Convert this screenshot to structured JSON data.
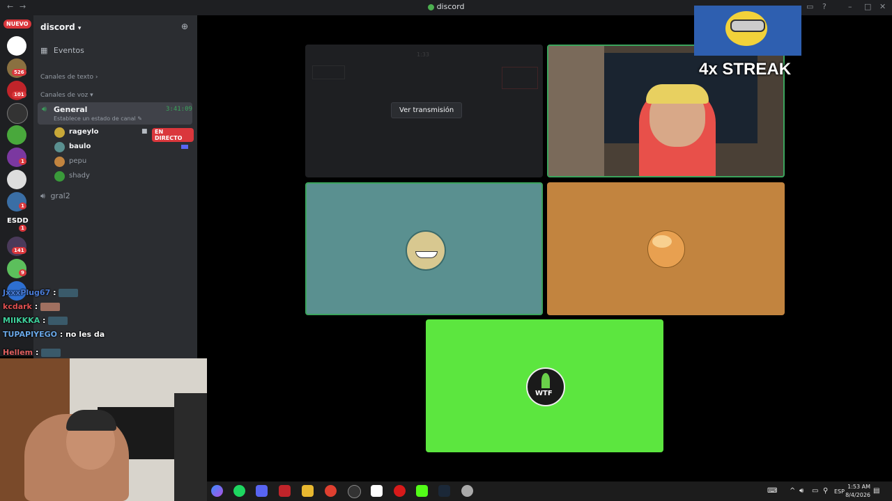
{
  "window": {
    "title": "discord"
  },
  "rail": {
    "nuevo_label": "NUEVO",
    "server_badges": [
      "526",
      "101",
      "1",
      "1",
      "1",
      "141",
      "9",
      "ESDD"
    ],
    "esdd_label": "ESDD",
    "esdd_badge": "1"
  },
  "sidebar": {
    "server_name": "discord",
    "events_label": "Eventos",
    "text_category": "Canales de texto",
    "voice_category": "Canales de voz",
    "voice_channels": [
      {
        "name": "General",
        "timer": "3:41:09",
        "status": "Establece un estado de canal"
      },
      {
        "name": "gral2"
      }
    ],
    "users": [
      {
        "name": "rageylo",
        "live": "EN DIRECTO"
      },
      {
        "name": "baulo"
      },
      {
        "name": "pepu"
      },
      {
        "name": "shady"
      }
    ]
  },
  "chat": [
    {
      "user": "JxxxPlug67",
      "sep": " :",
      "text": ""
    },
    {
      "user": "kcdark",
      "sep": " :",
      "text": ""
    },
    {
      "user": "MIIKKKA",
      "sep": " :",
      "text": ""
    },
    {
      "user": "TUPAPIYEGO",
      "sep": " :",
      "text": "no les da"
    },
    {
      "user": "Hellem",
      "sep": " :",
      "text": ""
    }
  ],
  "stage": {
    "watch_stream_label": "Ver transmisión",
    "preview_timer": "1:33",
    "streak_text": "4x STREAK",
    "wtf_label": "WTF"
  },
  "colors": {
    "tile_teal": "#5a9090",
    "tile_orange": "#c2843f",
    "tile_green": "#5ce63f",
    "speaking_border": "#3ba55d",
    "live_red": "#da373c"
  },
  "taskbar": {
    "language": "ESP",
    "time": "1:53 AM",
    "date": "8/4/2026"
  }
}
